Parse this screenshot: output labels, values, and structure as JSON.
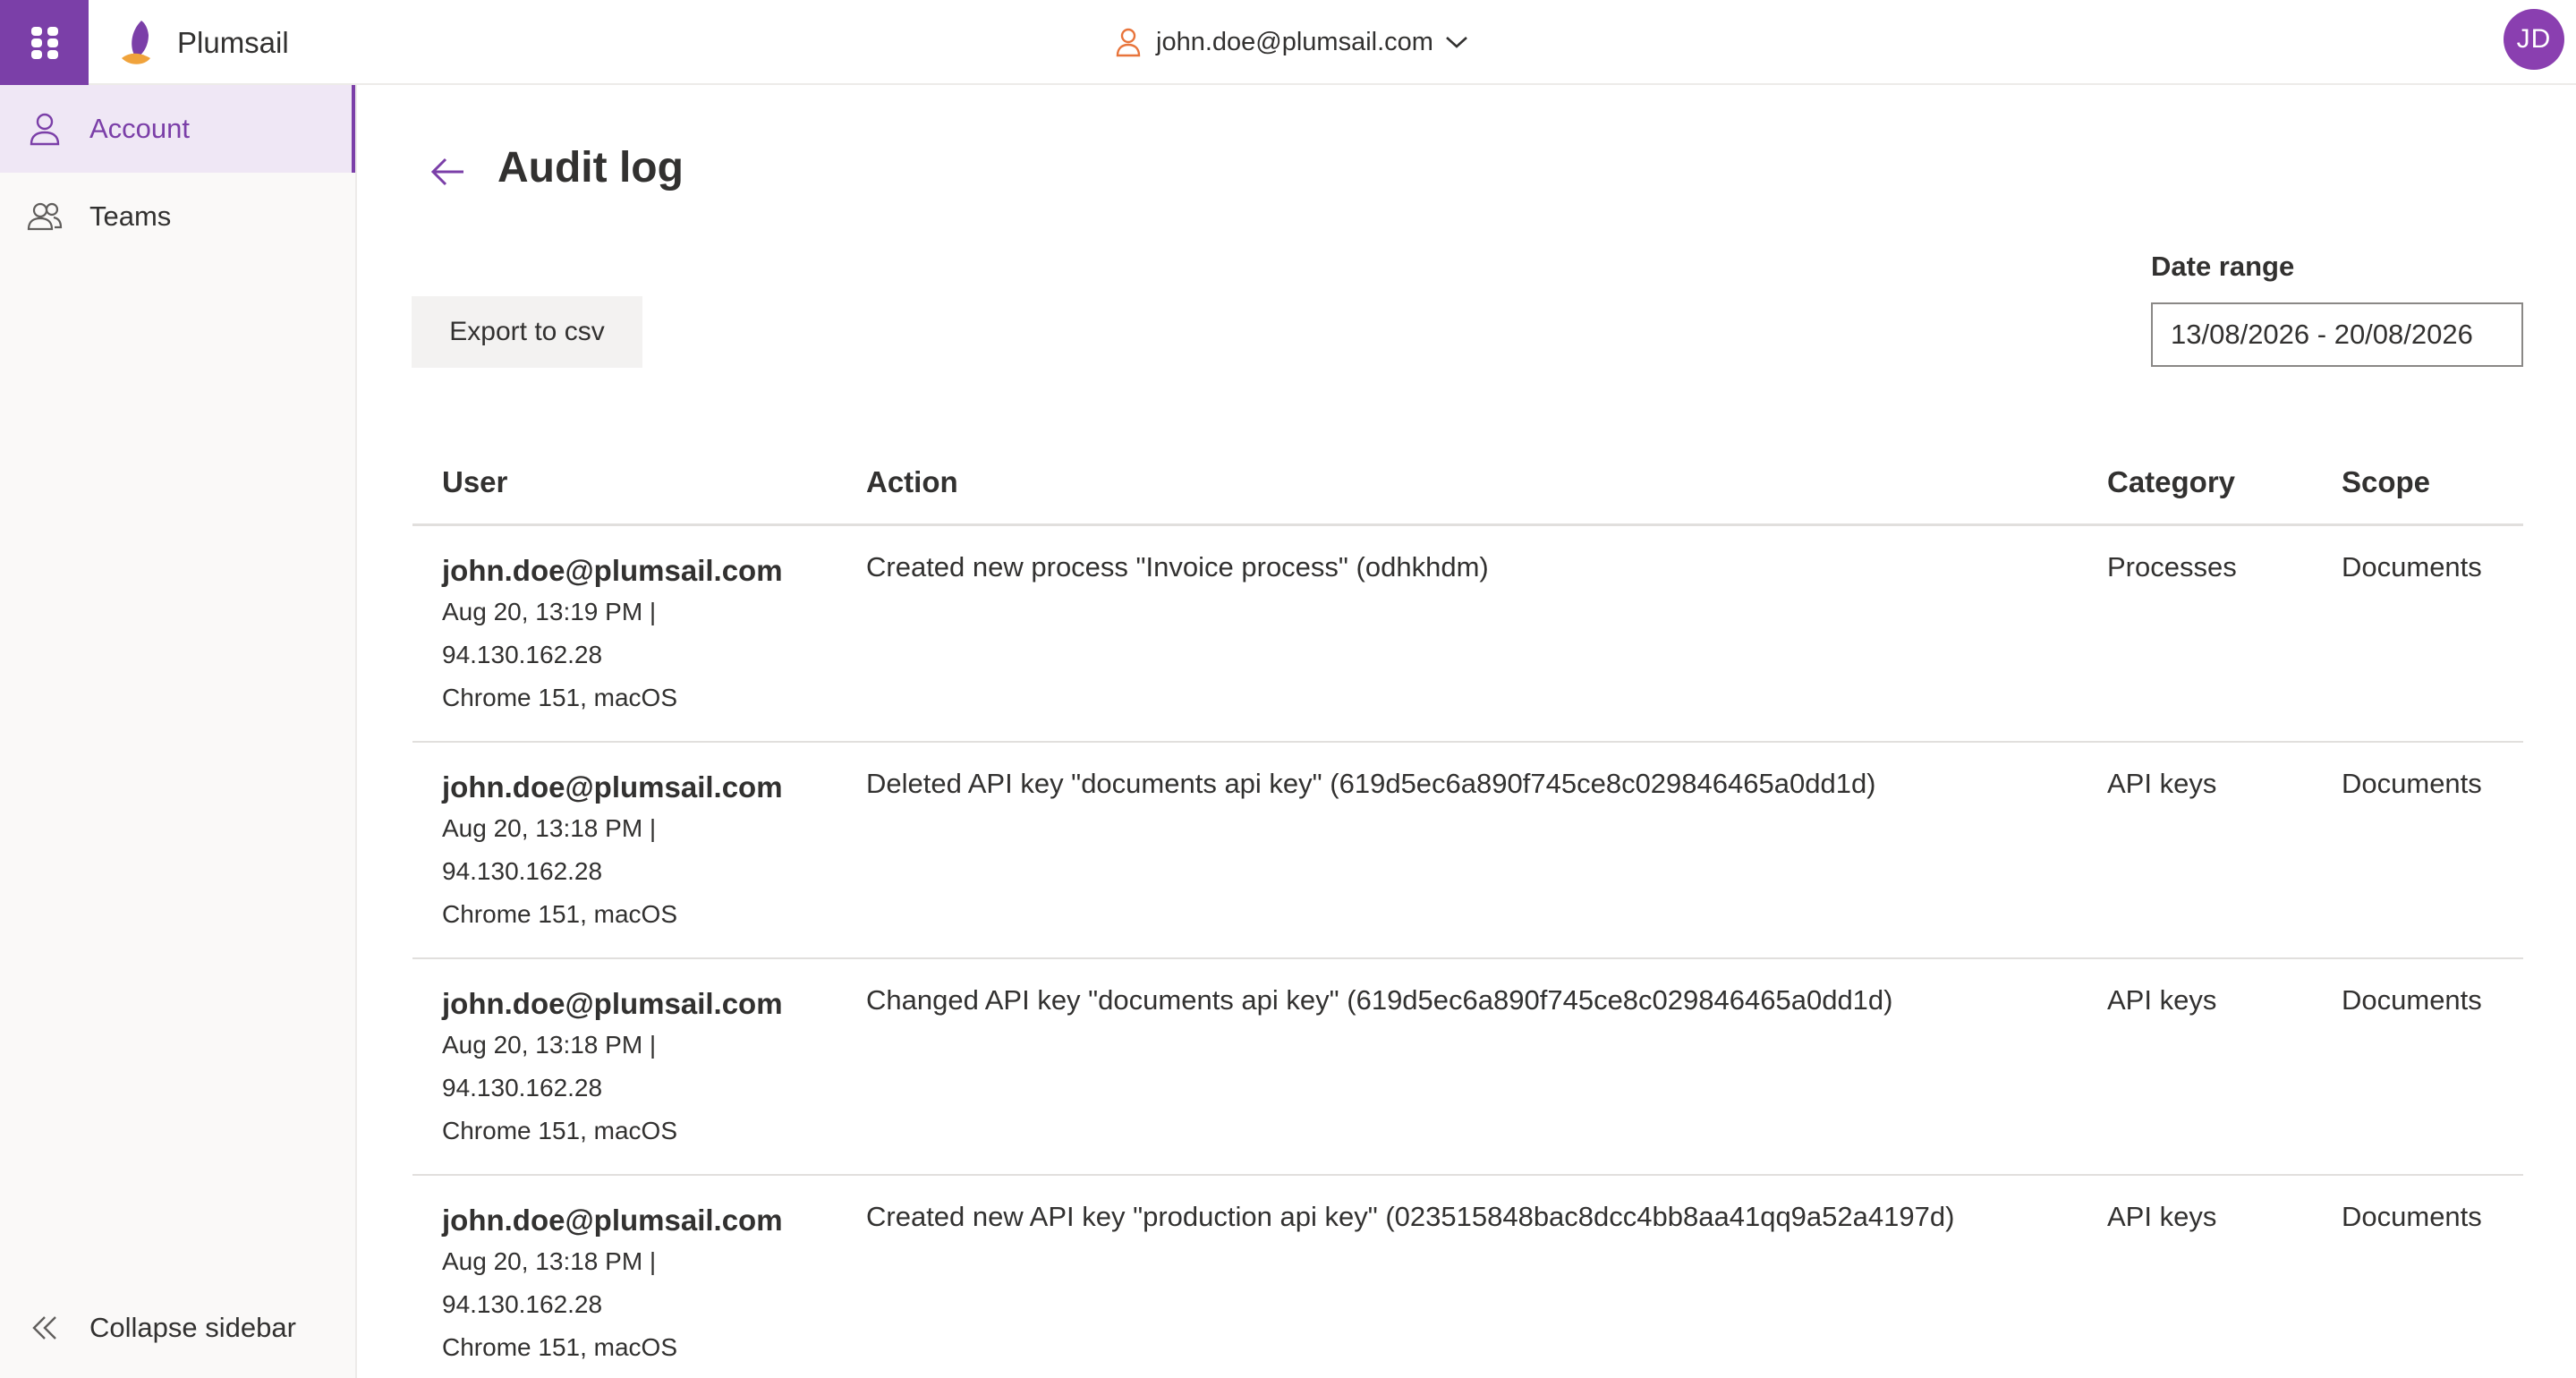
{
  "header": {
    "brand_name": "Plumsail",
    "user_email": "john.doe@plumsail.com",
    "avatar_initials": "JD"
  },
  "sidebar": {
    "items": [
      {
        "label": "Account",
        "icon": "person-icon",
        "active": true
      },
      {
        "label": "Teams",
        "icon": "people-icon",
        "active": false
      }
    ],
    "collapse_label": "Collapse sidebar"
  },
  "page": {
    "title": "Audit log",
    "export_label": "Export to csv",
    "date_range_label": "Date range",
    "date_range_value": "13/08/2026 - 20/08/2026"
  },
  "table": {
    "columns": [
      "User",
      "Action",
      "Category",
      "Scope"
    ],
    "rows": [
      {
        "user": "john.doe@plumsail.com",
        "time": "Aug 20, 13:19 PM |",
        "ip": "94.130.162.28",
        "agent": "Chrome 151, macOS",
        "action": "Created new process \"Invoice process\" (odhkhdm)",
        "category": "Processes",
        "scope": "Documents"
      },
      {
        "user": "john.doe@plumsail.com",
        "time": "Aug 20, 13:18 PM |",
        "ip": "94.130.162.28",
        "agent": "Chrome 151, macOS",
        "action": "Deleted API key \"documents api key\" (619d5ec6a890f745ce8c029846465a0dd1d)",
        "category": "API keys",
        "scope": "Documents"
      },
      {
        "user": "john.doe@plumsail.com",
        "time": "Aug 20, 13:18 PM |",
        "ip": "94.130.162.28",
        "agent": "Chrome 151, macOS",
        "action": "Changed API key \"documents api key\" (619d5ec6a890f745ce8c029846465a0dd1d)",
        "category": "API keys",
        "scope": "Documents"
      },
      {
        "user": "john.doe@plumsail.com",
        "time": "Aug 20, 13:18 PM |",
        "ip": "94.130.162.28",
        "agent": "Chrome 151, macOS",
        "action": "Created new API key \"production api key\" (023515848bac8dcc4bb8aa41qq9a52a4197d)",
        "category": "API keys",
        "scope": "Documents"
      }
    ]
  },
  "colors": {
    "accent": "#7b3fa8",
    "avatar": "#8a3fb0",
    "sidebar_bg": "#faf9f8",
    "active_bg": "#efe7f5"
  }
}
